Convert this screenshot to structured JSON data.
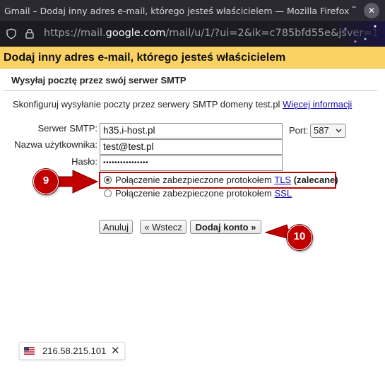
{
  "window": {
    "title": "Gmail – Dodaj inny adres e-mail, którego jesteś właścicielem — Mozilla Firefox",
    "url_prefix": "https://mail.",
    "url_domain": "google.com",
    "url_rest": "/mail/u/1/?ui=2&ik=c785bfd55e&jsver=1"
  },
  "dialog": {
    "title": "Dodaj inny adres e-mail, którego jesteś właścicielem",
    "section_title": "Wysyłaj pocztę przez swój serwer SMTP",
    "intro_text": "Skonfiguruj wysyłanie poczty przez serwery SMTP domeny test.pl",
    "more_info_link": "Więcej informacji"
  },
  "form": {
    "smtp_label": "Serwer SMTP:",
    "smtp_value": "h35.i-host.pl",
    "port_label": "Port:",
    "port_value": "587",
    "username_label": "Nazwa użytkownika:",
    "username_value": "test@test.pl",
    "password_label": "Hasło:",
    "password_value": "••••••••••••••••",
    "options": [
      {
        "prefix": "Połączenie zabezpieczone protokołem",
        "link": "TLS",
        "suffix": "(zalecane)",
        "selected": true
      },
      {
        "prefix": "Połączenie zabezpieczone protokołem",
        "link": "SSL",
        "suffix": "",
        "selected": false
      }
    ]
  },
  "buttons": {
    "cancel": "Anuluj",
    "back": "« Wstecz",
    "add": "Dodaj konto »"
  },
  "annotations": {
    "step_a": "9",
    "step_b": "10",
    "color": "#c00000"
  },
  "ip_bar": {
    "flag": "us-flag-icon",
    "ip": "216.58.215.101"
  }
}
